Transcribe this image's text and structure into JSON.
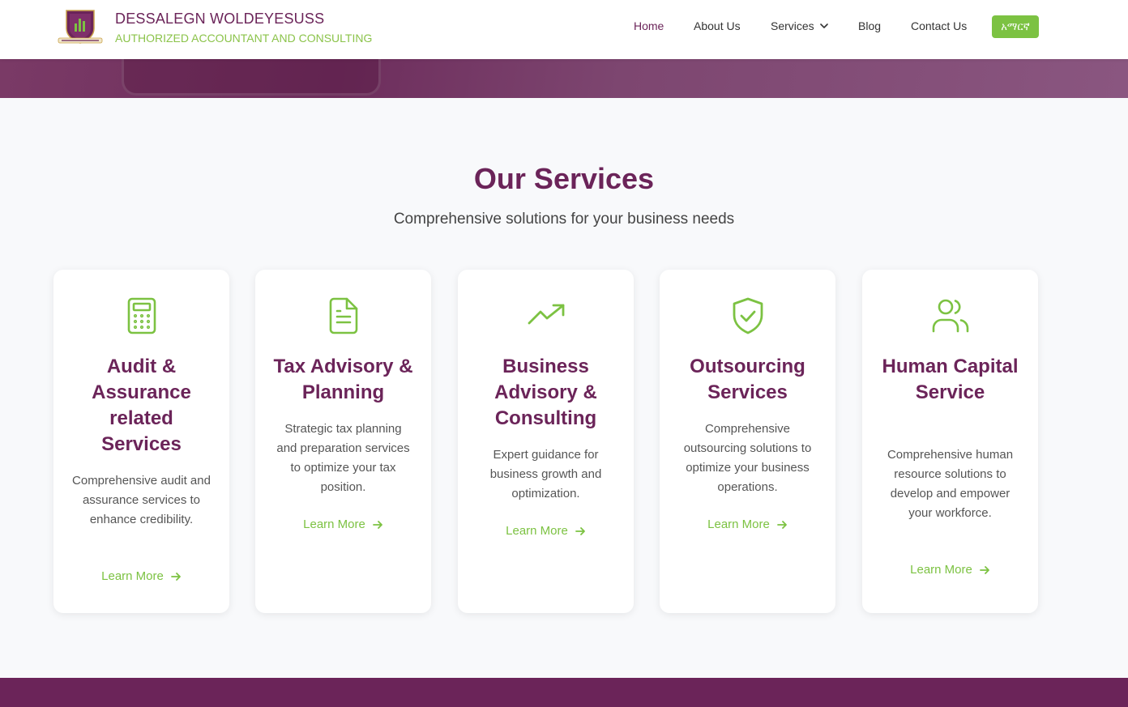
{
  "header": {
    "brand_name": "DESSALEGN WOLDEYESUSS",
    "brand_tagline": "AUTHORIZED ACCOUNTANT AND CONSULTING",
    "logo_icon": "company-logo-shield",
    "nav": {
      "home": "Home",
      "about": "About Us",
      "services": "Services",
      "blog": "Blog",
      "contact": "Contact Us"
    },
    "language_button": "አማርኛ"
  },
  "services_section": {
    "title": "Our Services",
    "subtitle": "Comprehensive solutions for your business needs",
    "cards": [
      {
        "icon": "calculator-icon",
        "title": "Audit & Assurance related Services",
        "description": "Comprehensive audit and assurance services to enhance credibility.",
        "link": "Learn More"
      },
      {
        "icon": "document-icon",
        "title": "Tax Advisory & Planning",
        "description": "Strategic tax planning and preparation services to optimize your tax position.",
        "link": "Learn More"
      },
      {
        "icon": "trending-up-icon",
        "title": "Business Advisory & Consulting",
        "description": "Expert guidance for business growth and optimization.",
        "link": "Learn More"
      },
      {
        "icon": "shield-check-icon",
        "title": "Outsourcing Services",
        "description": "Comprehensive outsourcing solutions to optimize your business operations.",
        "link": "Learn More"
      },
      {
        "icon": "users-icon",
        "title": "Human Capital Service",
        "description": "Comprehensive human resource solutions to develop and empower your workforce.",
        "link": "Learn More"
      }
    ]
  },
  "colors": {
    "brand_purple": "#6b2459",
    "accent_green": "#7cc242"
  }
}
